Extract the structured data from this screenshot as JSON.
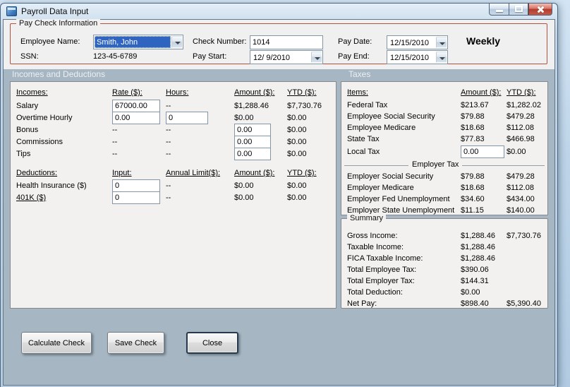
{
  "window": {
    "title": "Payroll Data Input"
  },
  "paycheck": {
    "group_title": "Pay Check Information",
    "employee_name": {
      "label": "Employee Name:",
      "value": "Smith, John"
    },
    "ssn": {
      "label": "SSN:",
      "value": "123-45-6789"
    },
    "check_number": {
      "label": "Check Number:",
      "value": "1014"
    },
    "pay_start": {
      "label": "Pay Start:",
      "value": "12/ 9/2010"
    },
    "pay_date": {
      "label": "Pay Date:",
      "value": "12/15/2010"
    },
    "pay_end": {
      "label": "Pay End:",
      "value": "12/15/2010"
    },
    "frequency": "Weekly"
  },
  "section_titles": {
    "incomes": "Incomes and Deductions",
    "taxes": "Taxes"
  },
  "incomes": {
    "headers": {
      "c1": "Incomes:",
      "c2": "Rate ($):",
      "c3": "Hours:",
      "c4": "Amount ($):",
      "c5": "YTD ($):"
    },
    "salary": {
      "label": "Salary",
      "rate": "67000.00",
      "hours": "--",
      "amount": "$1,288.46",
      "ytd": "$7,730.76"
    },
    "overtime": {
      "label": "Overtime Hourly",
      "rate": "0.00",
      "hours": "0",
      "amount": "$0.00",
      "ytd": "$0.00"
    },
    "bonus": {
      "label": "Bonus",
      "rate": "--",
      "hours": "--",
      "amount": "0.00",
      "ytd": "$0.00"
    },
    "commissions": {
      "label": "Commissions",
      "rate": "--",
      "hours": "--",
      "amount": "0.00",
      "ytd": "$0.00"
    },
    "tips": {
      "label": "Tips",
      "rate": "--",
      "hours": "--",
      "amount": "0.00",
      "ytd": "$0.00"
    }
  },
  "deductions": {
    "headers": {
      "c1": "Deductions:",
      "c2": "Input:",
      "c3": "Annual Limit($):",
      "c4": "Amount ($):",
      "c5": "YTD ($):"
    },
    "health": {
      "label": "Health Insurance  ($)",
      "input": "0",
      "limit": "--",
      "amount": "$0.00",
      "ytd": "$0.00"
    },
    "k401": {
      "label": "401K  ($)",
      "input": "0",
      "limit": "--",
      "amount": "$0.00",
      "ytd": "$0.00"
    }
  },
  "taxes": {
    "headers": {
      "c1": "Items:",
      "c2": "Amount ($):",
      "c3": "YTD ($):"
    },
    "rows": [
      {
        "label": "Federal Tax",
        "amount": "$213.67",
        "ytd": "$1,282.02"
      },
      {
        "label": "Employee Social Security",
        "amount": "$79.88",
        "ytd": "$479.28"
      },
      {
        "label": "Employee Medicare",
        "amount": "$18.68",
        "ytd": "$112.08"
      },
      {
        "label": "State Tax",
        "amount": "$77.83",
        "ytd": "$466.98"
      }
    ],
    "local": {
      "label": "Local Tax",
      "amount": "0.00",
      "ytd": "$0.00"
    },
    "employer_header": "Employer Tax",
    "employer_rows": [
      {
        "label": "Employer Social Security",
        "amount": "$79.88",
        "ytd": "$479.28"
      },
      {
        "label": "Employer Medicare",
        "amount": "$18.68",
        "ytd": "$112.08"
      },
      {
        "label": "Employer Fed Unemployment",
        "amount": "$34.60",
        "ytd": "$434.00"
      },
      {
        "label": "Employer State Unemployment",
        "amount": "$11.15",
        "ytd": "$140.00"
      }
    ]
  },
  "summary": {
    "group_title": "Summary",
    "rows": [
      {
        "label": "Gross Income:",
        "amount": "$1,288.46",
        "ytd": "$7,730.76"
      },
      {
        "label": "Taxable Income:",
        "amount": "$1,288.46",
        "ytd": ""
      },
      {
        "label": "FICA Taxable Income:",
        "amount": "$1,288.46",
        "ytd": ""
      },
      {
        "label": "Total Employee Tax:",
        "amount": "$390.06",
        "ytd": ""
      },
      {
        "label": "Total Employer Tax:",
        "amount": "$144.31",
        "ytd": ""
      },
      {
        "label": "Total Deduction:",
        "amount": "$0.00",
        "ytd": ""
      },
      {
        "label": "Net Pay:",
        "amount": "$898.40",
        "ytd": "$5,390.40"
      }
    ]
  },
  "buttons": {
    "calculate": "Calculate Check",
    "save": "Save Check",
    "close": "Close"
  }
}
